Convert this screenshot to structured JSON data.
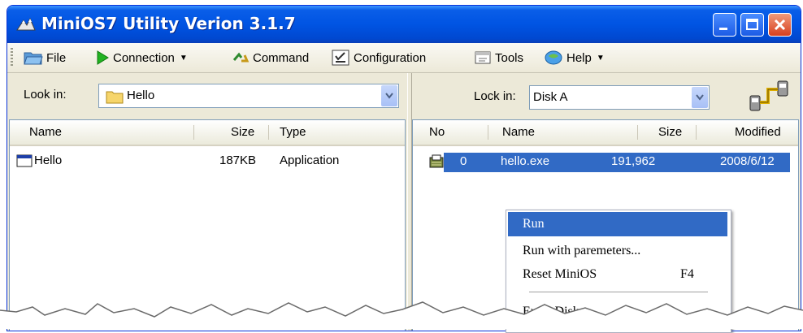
{
  "window": {
    "title": "MiniOS7 Utility Verion 3.1.7"
  },
  "toolbar": {
    "file": "File",
    "connection": "Connection",
    "command": "Command",
    "configuration": "Configuration",
    "tools": "Tools",
    "help": "Help"
  },
  "left_pane": {
    "look_in_label": "Look in:",
    "folder": "Hello",
    "columns": {
      "name": "Name",
      "size": "Size",
      "type": "Type"
    },
    "rows": [
      {
        "name": "Hello",
        "size": "187KB",
        "type": "Application"
      }
    ]
  },
  "right_pane": {
    "look_in_label": "Lock in:",
    "disk": "Disk A",
    "columns": {
      "no": "No",
      "name": "Name",
      "size": "Size",
      "modified": "Modified"
    },
    "rows": [
      {
        "no": "0",
        "name": "hello.exe",
        "size": "191,962",
        "modified": "2008/6/12"
      }
    ]
  },
  "context_menu": {
    "run": "Run",
    "run_with_params": "Run with paremeters...",
    "reset": "Reset MiniOS",
    "reset_shortcut": "F4",
    "erase": "Erase Disk"
  },
  "colors": {
    "title_bar": "#0054e3",
    "selection": "#316ac5",
    "close_button": "#d7401e"
  }
}
